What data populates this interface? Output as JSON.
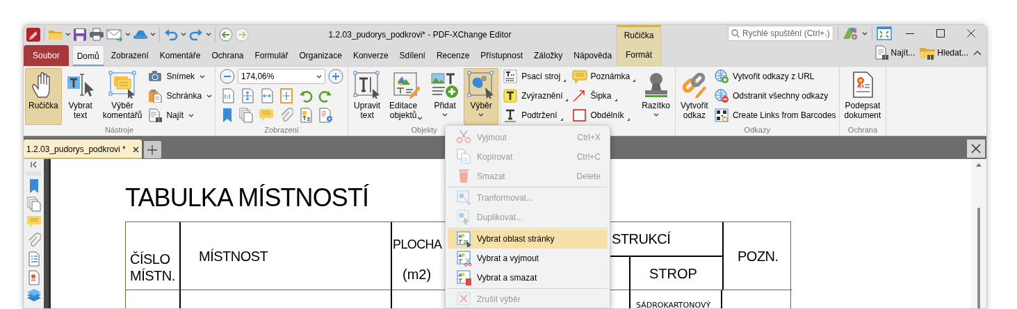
{
  "window": {
    "title": "1.2.03_pudorys_podkrovi* - PDF-XChange Editor"
  },
  "quick_search": {
    "placeholder": "Rychlé spuštění (Ctrl+.)"
  },
  "context_header": "Ručička",
  "menu_tabs": [
    {
      "label": "Soubor",
      "kind": "file",
      "selected": false
    },
    {
      "label": "Domů",
      "kind": "tab",
      "selected": true
    },
    {
      "label": "Zobrazení",
      "kind": "tab",
      "selected": false
    },
    {
      "label": "Komentáře",
      "kind": "tab",
      "selected": false
    },
    {
      "label": "Ochrana",
      "kind": "tab",
      "selected": false
    },
    {
      "label": "Formulář",
      "kind": "tab",
      "selected": false
    },
    {
      "label": "Organizace",
      "kind": "tab",
      "selected": false
    },
    {
      "label": "Konverze",
      "kind": "tab",
      "selected": false
    },
    {
      "label": "Sdílení",
      "kind": "tab",
      "selected": false
    },
    {
      "label": "Recenze",
      "kind": "tab",
      "selected": false
    },
    {
      "label": "Přístupnost",
      "kind": "tab",
      "selected": false
    },
    {
      "label": "Záložky",
      "kind": "tab",
      "selected": false
    },
    {
      "label": "Nápověda",
      "kind": "tab",
      "selected": false
    },
    {
      "label": "Formát",
      "kind": "context",
      "selected": false
    }
  ],
  "tab_row_tools": [
    {
      "label": "Najít..."
    },
    {
      "label": "Hledat..."
    }
  ],
  "ribbon": {
    "groups": [
      {
        "label": "Nástroje",
        "items": [
          {
            "kind": "large",
            "label": "Ručička",
            "selected": true,
            "dropdown": false
          },
          {
            "kind": "large",
            "label": "Vybrat text",
            "selected": false,
            "dropdown": false
          },
          {
            "kind": "large",
            "label": "Výběr komentářů",
            "selected": false,
            "dropdown": false
          },
          {
            "kind": "column",
            "items": [
              {
                "label": "Snímek",
                "dropdown": true
              },
              {
                "label": "Schránka",
                "dropdown": true
              },
              {
                "label": "Najít",
                "dropdown": true
              }
            ]
          }
        ]
      },
      {
        "label": "Zobrazení",
        "items": [
          {
            "kind": "zoom",
            "value": "174,06%"
          }
        ]
      },
      {
        "label": "Objekty",
        "items": [
          {
            "kind": "large",
            "label": "Upravit text",
            "selected": false,
            "dropdown": false
          },
          {
            "kind": "large",
            "label": "Editace objektů",
            "selected": false,
            "dropdown": true
          },
          {
            "kind": "large",
            "label": "Přidat",
            "selected": false,
            "dropdown": true
          },
          {
            "kind": "large",
            "label": "Výběr",
            "selected": true,
            "dropdown": true
          }
        ]
      },
      {
        "items": [
          {
            "kind": "column",
            "items": [
              {
                "label": "Psací stroj",
                "dropdown": true
              },
              {
                "label": "Zvýraznění",
                "dropdown": true
              },
              {
                "label": "Podtržení",
                "dropdown": true
              }
            ]
          },
          {
            "kind": "column",
            "items": [
              {
                "label": "Poznámka",
                "dropdown": true
              },
              {
                "label": "Šipka",
                "dropdown": true
              },
              {
                "label": "Obdélník",
                "dropdown": true
              }
            ]
          },
          {
            "kind": "large",
            "label": "Razítko",
            "selected": false,
            "dropdown": true
          }
        ]
      },
      {
        "label": "Odkazy",
        "items": [
          {
            "kind": "large",
            "label": "Vytvořit odkaz",
            "selected": false,
            "dropdown": false
          },
          {
            "kind": "column",
            "items": [
              {
                "label": "Vytvořit odkazy z URL",
                "dropdown": false
              },
              {
                "label": "Odstranit všechny odkazy",
                "dropdown": false
              },
              {
                "label": "Create Links from Barcodes",
                "dropdown": false
              }
            ]
          }
        ]
      },
      {
        "label": "Ochrana",
        "items": [
          {
            "kind": "large",
            "label": "Podepsat dokument",
            "selected": false,
            "dropdown": false
          }
        ]
      }
    ]
  },
  "document_tabs": [
    {
      "label": "1.2.03_pudorys_podkrovi *",
      "selected": true
    }
  ],
  "document": {
    "title": "TABULKA MÍSTNOSTÍ",
    "table": {
      "number_header": "ČÍSLO MÍSTN.",
      "room_header": "MÍSTNOST",
      "area_header": "PLOCHA",
      "area_unit": "(m2)",
      "column_4_header": "STRUKCÍ",
      "column_4_sub": "STROP",
      "notes_header": "POZN.",
      "row_1_strop": "SÁDROKARTONOVÝ"
    }
  },
  "dropdown_menu": {
    "items": [
      {
        "kind": "item",
        "label": "Vyjmout",
        "shortcut": "Ctrl+X",
        "disabled": true,
        "selected": false
      },
      {
        "kind": "item",
        "label": "Kopírovat",
        "shortcut": "Ctrl+C",
        "disabled": true,
        "selected": false
      },
      {
        "kind": "item",
        "label": "Smazat",
        "shortcut": "Delete",
        "disabled": true,
        "selected": false
      },
      {
        "kind": "separator"
      },
      {
        "kind": "item",
        "label": "Tranformovat...",
        "disabled": true,
        "selected": false
      },
      {
        "kind": "item",
        "label": "Duplikovat...",
        "disabled": true,
        "selected": false
      },
      {
        "kind": "separator"
      },
      {
        "kind": "item",
        "label": "Vybrat oblast stránky",
        "disabled": false,
        "selected": true
      },
      {
        "kind": "item",
        "label": "Vybrat a vyjmout",
        "disabled": false,
        "selected": false
      },
      {
        "kind": "item",
        "label": "Vybrat a smazat",
        "disabled": false,
        "selected": false
      },
      {
        "kind": "separator"
      },
      {
        "kind": "item",
        "label": "Zrušit výběr",
        "disabled": true,
        "selected": false
      }
    ]
  }
}
